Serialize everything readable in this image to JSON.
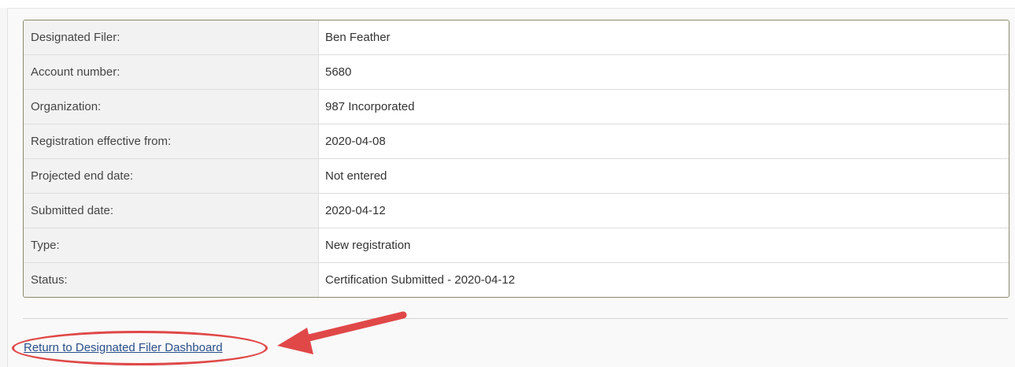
{
  "registration_details": {
    "rows": [
      {
        "label": "Designated Filer:",
        "value": "Ben Feather"
      },
      {
        "label": "Account number:",
        "value": "5680"
      },
      {
        "label": "Organization:",
        "value": "987 Incorporated"
      },
      {
        "label": "Registration effective from:",
        "value": "2020-04-08"
      },
      {
        "label": "Projected end date:",
        "value": "Not entered"
      },
      {
        "label": "Submitted date:",
        "value": "2020-04-12"
      },
      {
        "label": "Type:",
        "value": "New registration"
      },
      {
        "label": "Status:",
        "value": "Certification Submitted - 2020-04-12"
      }
    ]
  },
  "footer": {
    "return_link_label": "Return to Designated Filer Dashboard"
  },
  "annotation": {
    "highlight_color": "#e04848",
    "arrow_color": "#e04848"
  }
}
